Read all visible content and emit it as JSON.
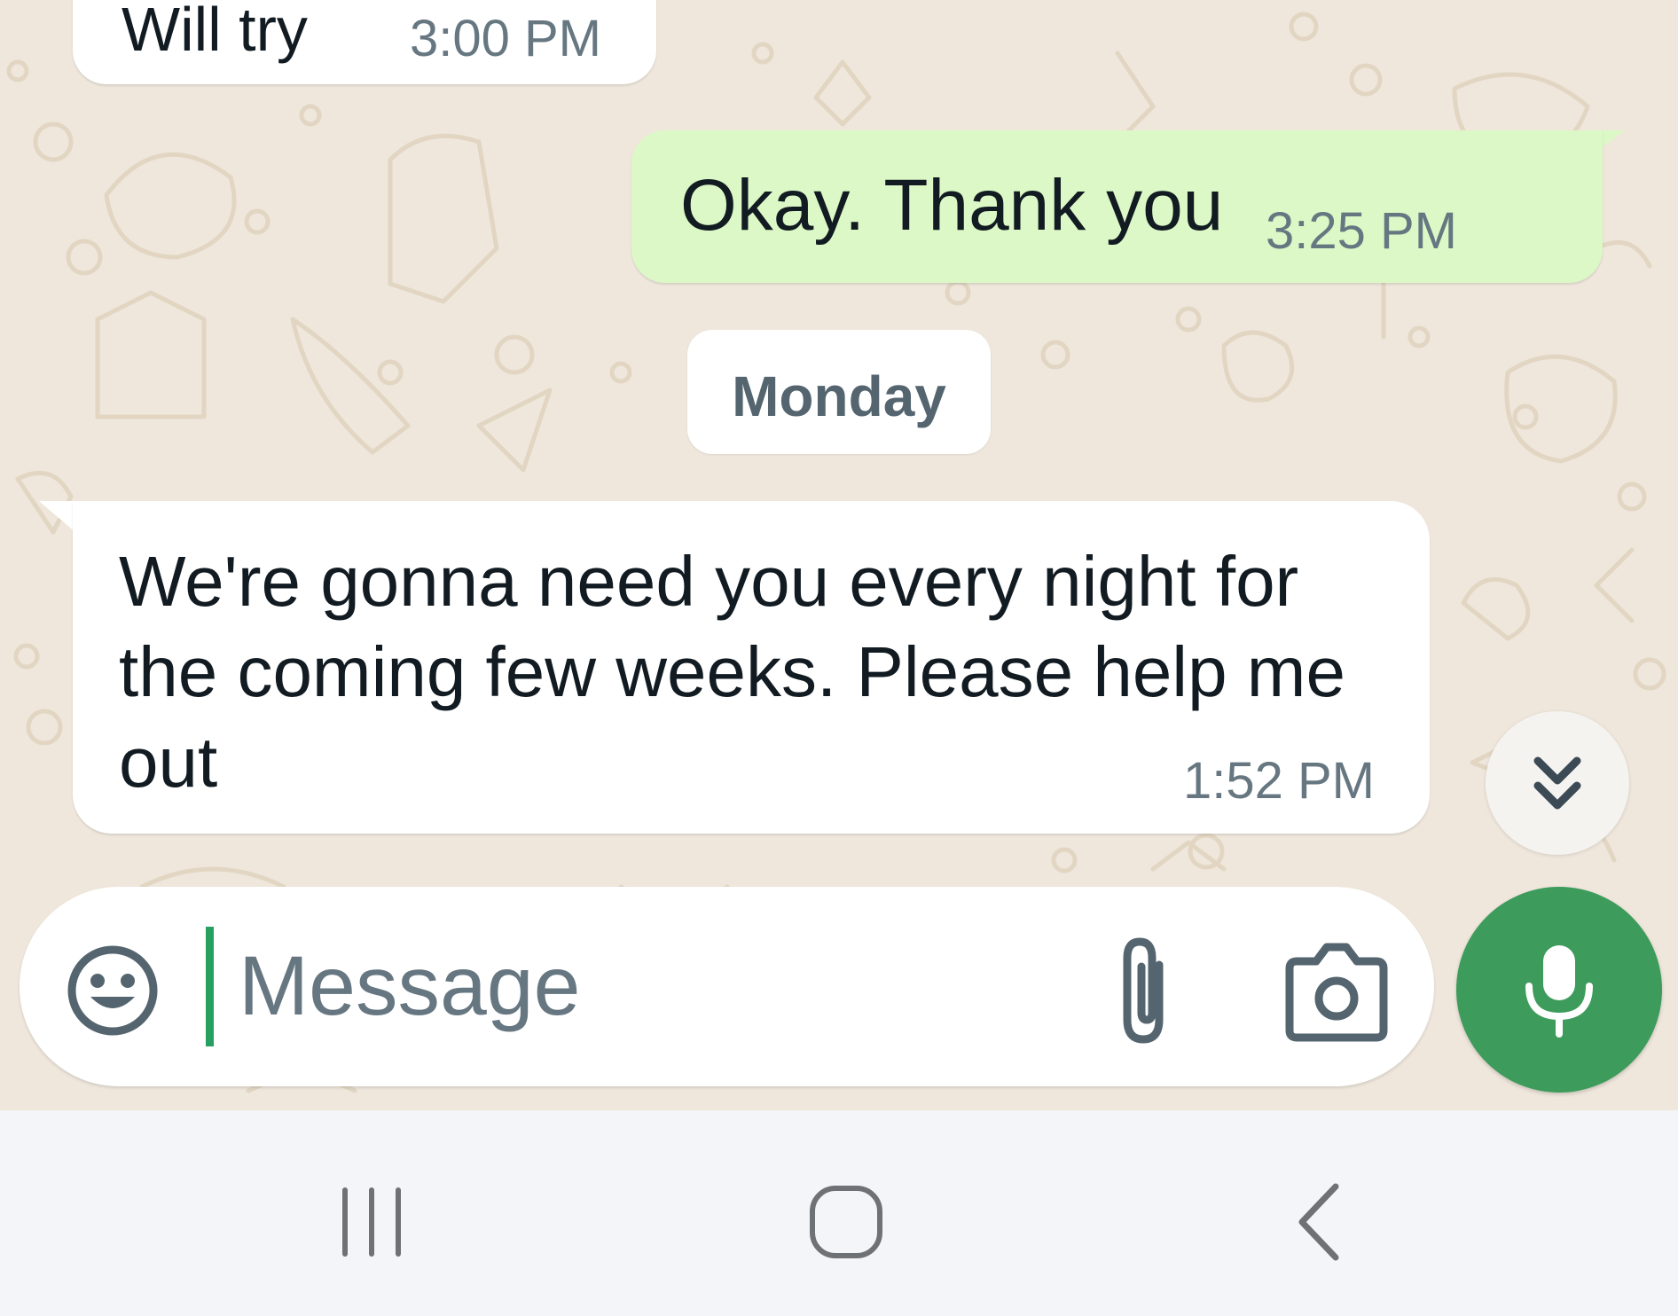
{
  "messages": [
    {
      "direction": "incoming",
      "text": "Will try",
      "time": "3:00 PM"
    },
    {
      "direction": "outgoing",
      "text": "Okay. Thank you",
      "time": "3:25 PM",
      "status_icon": "double-check-read-icon",
      "status_color": "#34b7f1"
    },
    {
      "direction": "incoming",
      "text": "We're gonna need you every night for the coming few weeks. Please help me out",
      "time": "1:52 PM"
    }
  ],
  "date_separator": "Monday",
  "composer": {
    "placeholder": "Message",
    "value": "",
    "emoji_icon": "emoji-icon",
    "attach_icon": "paperclip-icon",
    "camera_icon": "camera-icon",
    "mic_icon": "microphone-icon"
  },
  "scroll_button_icon": "double-chevron-down-icon",
  "colors": {
    "outgoing_bubble": "#dcf8c6",
    "incoming_bubble": "#ffffff",
    "wallpaper": "#efe7dc",
    "accent_green": "#3d9c5b",
    "cursor_green": "#25a060"
  },
  "navigation": {
    "recent_icon": "recent-apps-icon",
    "home_icon": "home-icon",
    "back_icon": "back-icon"
  }
}
